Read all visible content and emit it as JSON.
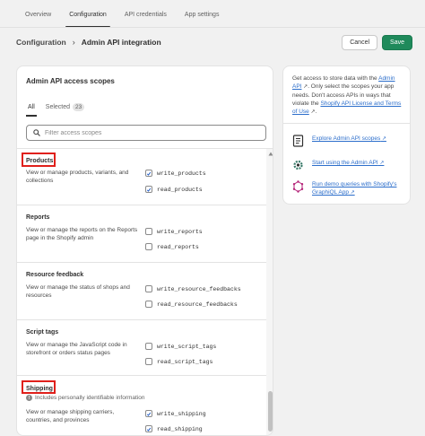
{
  "nav_tabs": [
    {
      "label": "Overview"
    },
    {
      "label": "Configuration"
    },
    {
      "label": "API credentials"
    },
    {
      "label": "App settings"
    }
  ],
  "breadcrumb": {
    "parent": "Configuration",
    "separator": "›",
    "current": "Admin API integration"
  },
  "buttons": {
    "cancel": "Cancel",
    "save": "Save"
  },
  "scopes_card": {
    "title": "Admin API access scopes",
    "tabs": {
      "all": "All",
      "selected": "Selected",
      "selected_count": "23"
    },
    "search_placeholder": "Filter access scopes",
    "sections": [
      {
        "title": "Products",
        "description": "View or manage products, variants, and collections",
        "scopes": [
          {
            "name": "write_products",
            "checked": true
          },
          {
            "name": "read_products",
            "checked": true
          }
        ]
      },
      {
        "title": "Reports",
        "description": "View or manage the reports on the Reports page in the Shopify admin",
        "scopes": [
          {
            "name": "write_reports",
            "checked": false
          },
          {
            "name": "read_reports",
            "checked": false
          }
        ]
      },
      {
        "title": "Resource feedback",
        "description": "View or manage the status of shops and resources",
        "scopes": [
          {
            "name": "write_resource_feedbacks",
            "checked": false
          },
          {
            "name": "read_resource_feedbacks",
            "checked": false
          }
        ]
      },
      {
        "title": "Script tags",
        "description": "View or manage the JavaScript code in storefront or orders status pages",
        "scopes": [
          {
            "name": "write_script_tags",
            "checked": false
          },
          {
            "name": "read_script_tags",
            "checked": false
          }
        ]
      },
      {
        "title": "Shipping",
        "note": "Includes personally identifiable information",
        "description": "View or manage shipping carriers, countries, and provinces",
        "scopes": [
          {
            "name": "write_shipping",
            "checked": true
          },
          {
            "name": "read_shipping",
            "checked": true
          }
        ]
      }
    ]
  },
  "side_card": {
    "text_1": "Get access to store data with the ",
    "link_admin_api": "Admin API",
    "text_2": ". Only select the scopes your app needs. Don't access APIs in ways that violate the ",
    "link_license": "Shopify API License and Terms of Use",
    "text_3": ".",
    "resources": [
      {
        "label": "Explore Admin API scopes",
        "icon": "document-icon"
      },
      {
        "label": "Start using the Admin API",
        "icon": "code-gear-icon"
      },
      {
        "label": "Run demo queries with Shopify's GraphiQL App",
        "icon": "graphql-icon"
      }
    ]
  },
  "colors": {
    "accent_green": "#1f8a5b",
    "link_blue": "#2c6ecb",
    "highlight_red": "#e0201b"
  }
}
